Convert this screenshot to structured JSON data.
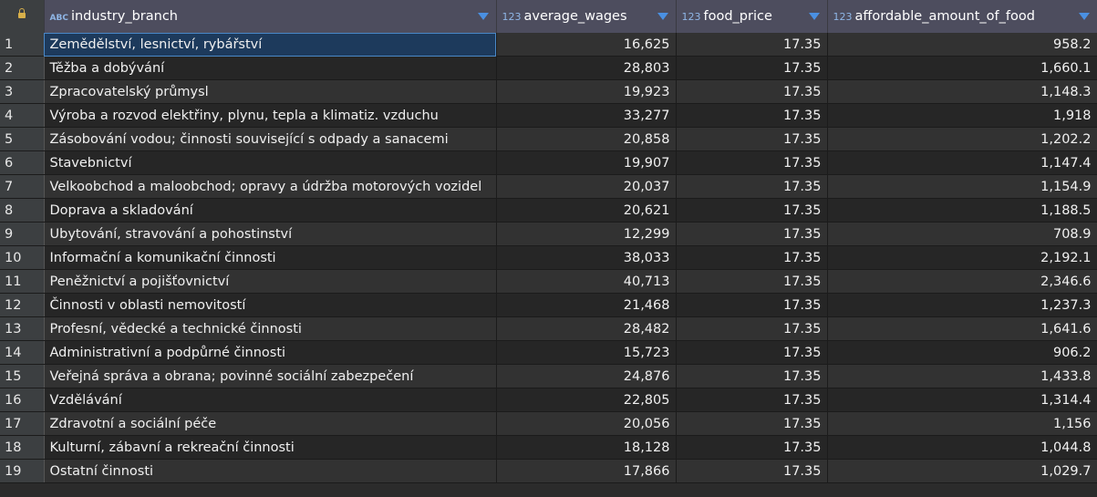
{
  "grid": {
    "columns": [
      {
        "type": "ABC",
        "name": "industry_branch"
      },
      {
        "type": "123",
        "name": "average_wages"
      },
      {
        "type": "123",
        "name": "food_price"
      },
      {
        "type": "123",
        "name": "affordable_amount_of_food"
      }
    ],
    "rows": [
      {
        "n": "1",
        "branch": "Zemědělství, lesnictví, rybářství",
        "wages": "16,625",
        "price": "17.35",
        "amount": "958.2"
      },
      {
        "n": "2",
        "branch": "Těžba a dobývání",
        "wages": "28,803",
        "price": "17.35",
        "amount": "1,660.1"
      },
      {
        "n": "3",
        "branch": "Zpracovatelský průmysl",
        "wages": "19,923",
        "price": "17.35",
        "amount": "1,148.3"
      },
      {
        "n": "4",
        "branch": "Výroba a rozvod elektřiny, plynu, tepla a klimatiz. vzduchu",
        "wages": "33,277",
        "price": "17.35",
        "amount": "1,918"
      },
      {
        "n": "5",
        "branch": "Zásobování vodou; činnosti související s odpady a sanacemi",
        "wages": "20,858",
        "price": "17.35",
        "amount": "1,202.2"
      },
      {
        "n": "6",
        "branch": "Stavebnictví",
        "wages": "19,907",
        "price": "17.35",
        "amount": "1,147.4"
      },
      {
        "n": "7",
        "branch": "Velkoobchod a maloobchod; opravy a údržba motorových vozidel",
        "wages": "20,037",
        "price": "17.35",
        "amount": "1,154.9"
      },
      {
        "n": "8",
        "branch": "Doprava a skladování",
        "wages": "20,621",
        "price": "17.35",
        "amount": "1,188.5"
      },
      {
        "n": "9",
        "branch": "Ubytování, stravování a pohostinství",
        "wages": "12,299",
        "price": "17.35",
        "amount": "708.9"
      },
      {
        "n": "10",
        "branch": "Informační a komunikační činnosti",
        "wages": "38,033",
        "price": "17.35",
        "amount": "2,192.1"
      },
      {
        "n": "11",
        "branch": "Peněžnictví a pojišťovnictví",
        "wages": "40,713",
        "price": "17.35",
        "amount": "2,346.6"
      },
      {
        "n": "12",
        "branch": "Činnosti v oblasti nemovitostí",
        "wages": "21,468",
        "price": "17.35",
        "amount": "1,237.3"
      },
      {
        "n": "13",
        "branch": "Profesní, vědecké a technické činnosti",
        "wages": "28,482",
        "price": "17.35",
        "amount": "1,641.6"
      },
      {
        "n": "14",
        "branch": "Administrativní a podpůrné činnosti",
        "wages": "15,723",
        "price": "17.35",
        "amount": "906.2"
      },
      {
        "n": "15",
        "branch": "Veřejná správa a obrana; povinné sociální zabezpečení",
        "wages": "24,876",
        "price": "17.35",
        "amount": "1,433.8"
      },
      {
        "n": "16",
        "branch": "Vzdělávání",
        "wages": "22,805",
        "price": "17.35",
        "amount": "1,314.4"
      },
      {
        "n": "17",
        "branch": "Zdravotní a sociální péče",
        "wages": "20,056",
        "price": "17.35",
        "amount": "1,156"
      },
      {
        "n": "18",
        "branch": "Kulturní, zábavní a rekreační činnosti",
        "wages": "18,128",
        "price": "17.35",
        "amount": "1,044.8"
      },
      {
        "n": "19",
        "branch": "Ostatní činnosti",
        "wages": "17,866",
        "price": "17.35",
        "amount": "1,029.7"
      }
    ]
  }
}
